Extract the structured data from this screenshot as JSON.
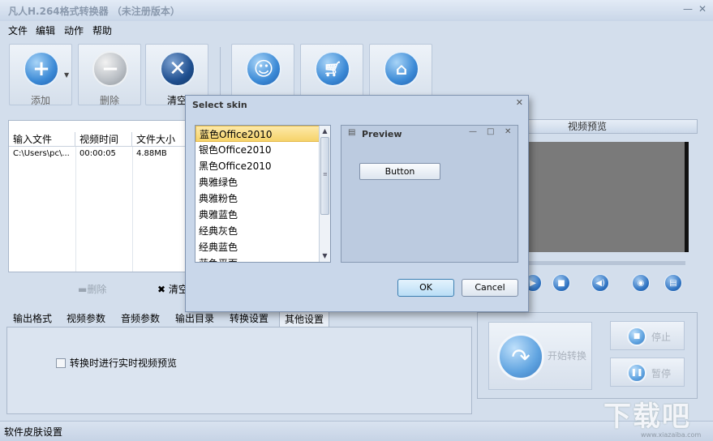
{
  "window": {
    "title": "凡人H.264格式转换器 （未注册版本）",
    "min_icon": "minimize-icon",
    "close_icon": "close-icon"
  },
  "menu": [
    "文件",
    "编辑",
    "动作",
    "帮助"
  ],
  "toolbar": {
    "add": "添加",
    "delete": "删除",
    "clear": "清空",
    "skin": "皮肤",
    "buy": "购买",
    "home": "主页"
  },
  "file_list": {
    "columns": [
      "输入文件",
      "视频时间",
      "文件大小"
    ],
    "rows": [
      {
        "file": "C:\\Users\\pc\\...",
        "duration": "00:00:05",
        "size": "4.88MB"
      }
    ],
    "remove_label": "删除",
    "clear_label": "清空"
  },
  "tabs": [
    "输出格式",
    "视频参数",
    "音频参数",
    "输出目录",
    "转换设置",
    "其他设置"
  ],
  "active_tab": "其他设置",
  "other_settings": {
    "realtime_preview_label": "转换时进行实时视频预览",
    "realtime_preview_checked": false
  },
  "video_preview": {
    "title": "视频预览"
  },
  "convert": {
    "start": "开始转换",
    "stop": "停止",
    "pause": "暂停"
  },
  "statusbar": {
    "text": "软件皮肤设置"
  },
  "watermark": {
    "text": "下载吧",
    "url": "www.xiazaiba.com"
  },
  "dialog": {
    "title": "Select skin",
    "skins": [
      "蓝色Office2010",
      "银色Office2010",
      "黑色Office2010",
      "典雅绿色",
      "典雅粉色",
      "典雅蓝色",
      "经典灰色",
      "经典蓝色",
      "蓝色平面"
    ],
    "selected_skin": "蓝色Office2010",
    "preview_title": "Preview",
    "preview_button": "Button",
    "ok": "OK",
    "cancel": "Cancel"
  }
}
